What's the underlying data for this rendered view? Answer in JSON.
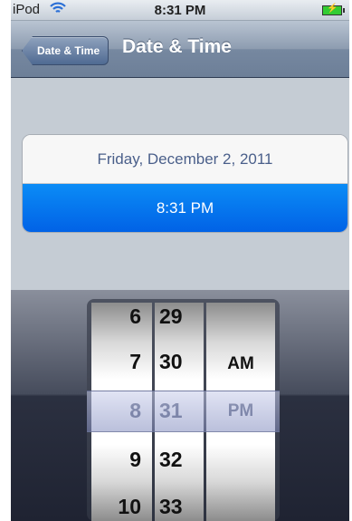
{
  "status_bar": {
    "carrier": "iPod",
    "time": "8:31 PM",
    "wifi_icon": "wifi-icon",
    "battery_icon": "battery-charging-icon"
  },
  "nav": {
    "back_label": "Date & Time",
    "title": "Date & Time"
  },
  "settings": {
    "date": "Friday, December 2, 2011",
    "time": "8:31 PM"
  },
  "picker": {
    "hours": [
      "6",
      "7",
      "8",
      "9",
      "10"
    ],
    "minutes": [
      "29",
      "30",
      "31",
      "32",
      "33"
    ],
    "ampm": [
      "",
      "AM",
      "PM",
      "",
      ""
    ],
    "selected": {
      "hour": "8",
      "minute": "31",
      "ampm": "PM"
    }
  },
  "colors": {
    "highlight": "#0b8cf6",
    "nav_bar": "#6d7f98",
    "background": "#c5ccd4"
  }
}
